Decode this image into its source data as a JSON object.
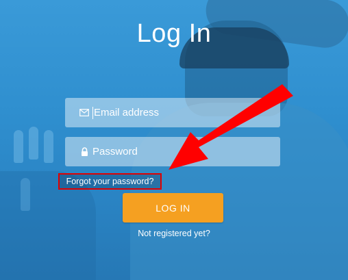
{
  "title": "Log In",
  "email": {
    "placeholder": "Email address",
    "icon": "envelope-icon"
  },
  "password": {
    "placeholder": "Password",
    "icon": "lock-icon"
  },
  "forgot_label": "Forgot your password?",
  "login_label": "LOG IN",
  "register_label": "Not registered yet?",
  "annotation": {
    "color": "#ff0000"
  },
  "colors": {
    "accent": "#f5a021",
    "background": "#2a86c7"
  }
}
